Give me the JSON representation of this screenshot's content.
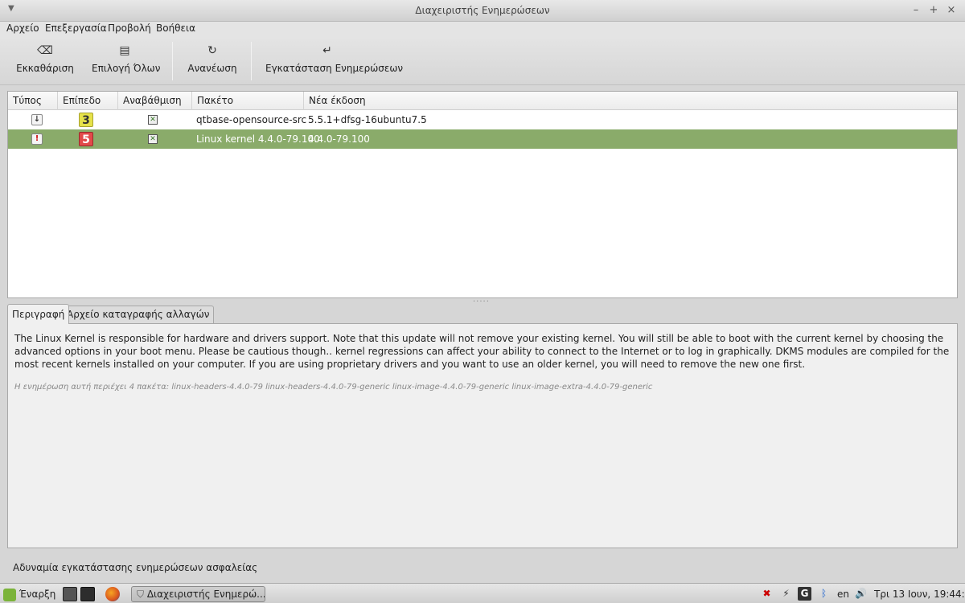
{
  "window": {
    "title": "Διαχειριστής Ενημερώσεων"
  },
  "menu": [
    "Αρχείο",
    "Επεξεργασία",
    "Προβολή",
    "Βοήθεια"
  ],
  "toolbar": {
    "clear": "Εκκαθάριση",
    "select_all": "Επιλογή Όλων",
    "refresh": "Ανανέωση",
    "install": "Εγκατάσταση Ενημερώσεων"
  },
  "table": {
    "columns": [
      "Τύπος",
      "Επίπεδο",
      "Αναβάθμιση",
      "Πακέτο",
      "Νέα έκδοση"
    ],
    "rows": [
      {
        "type": "package-update-icon",
        "level": "3",
        "upgrade": true,
        "package": "qtbase-opensource-src",
        "version": "5.5.1+dfsg-16ubuntu7.5"
      },
      {
        "type": "kernel-warning-icon",
        "level": "5",
        "upgrade": true,
        "package": "Linux kernel 4.4.0-79.100",
        "version": "4.4.0-79.100"
      }
    ]
  },
  "tabs": [
    "Περιγραφή",
    "Αρχείο καταγραφής αλλαγών"
  ],
  "description": {
    "text": "The Linux Kernel is responsible for hardware and drivers support. Note that this update will not remove your existing kernel. You will still be able to boot with the current kernel by choosing the advanced options in your boot menu. Please be cautious though.. kernel regressions can affect your ability to connect to the Internet or to log in graphically. DKMS modules are compiled for the most recent kernels installed on your computer. If you are using proprietary drivers and you want to use an older kernel, you will need to remove the new one first.",
    "packages": "Η ενημέρωση αυτή περιέχει 4 πακέτα:  linux-headers-4.4.0-79 linux-headers-4.4.0-79-generic linux-image-4.4.0-79-generic linux-image-extra-4.4.0-79-generic"
  },
  "status": "Αδυναμία εγκατάστασης ενημερώσεων ασφαλείας",
  "taskbar": {
    "start": "Έναρξη",
    "window_button": "Διαχειριστής Ενημερώ...",
    "lang": "en",
    "clock": "Τρι 13 Ιουν, 19:44:44"
  },
  "colors": {
    "selection": "#8aab6a",
    "level3": "#e6e24a",
    "level5": "#e24a4a"
  }
}
